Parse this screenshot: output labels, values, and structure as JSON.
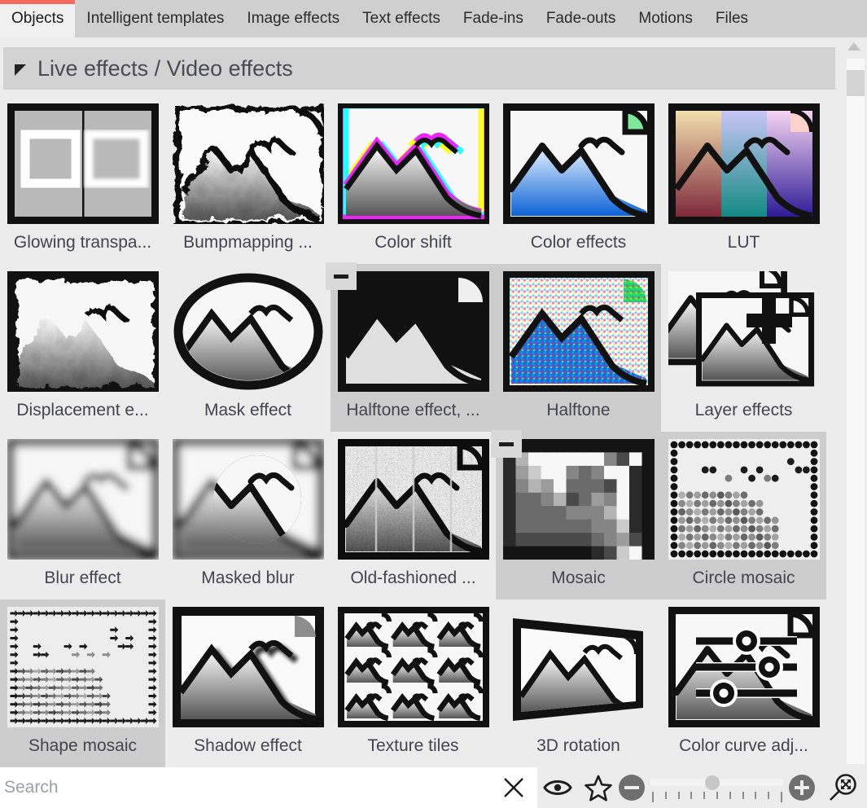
{
  "tabs": [
    {
      "label": "Objects",
      "active": true
    },
    {
      "label": "Intelligent templates",
      "active": false
    },
    {
      "label": "Image effects",
      "active": false
    },
    {
      "label": "Text effects",
      "active": false
    },
    {
      "label": "Fade-ins",
      "active": false
    },
    {
      "label": "Fade-outs",
      "active": false
    },
    {
      "label": "Motions",
      "active": false
    },
    {
      "label": "Files",
      "active": false
    }
  ],
  "accent_color": "#f2695e",
  "section": {
    "title": "Live effects / Video effects",
    "expanded": true,
    "collapse_icon": "triangle-down-icon"
  },
  "grid": {
    "columns": 5,
    "items": [
      {
        "label": "Glowing transpa...",
        "art": "glowing",
        "selected": false,
        "badge": false
      },
      {
        "label": "Bumpmapping ...",
        "art": "bumpmap",
        "selected": false,
        "badge": false
      },
      {
        "label": "Color shift",
        "art": "colorshift",
        "selected": false,
        "badge": false
      },
      {
        "label": "Color effects",
        "art": "coloreffects",
        "selected": false,
        "badge": false
      },
      {
        "label": "LUT",
        "art": "lut",
        "selected": false,
        "badge": false
      },
      {
        "label": "Displacement e...",
        "art": "displacement",
        "selected": false,
        "badge": false
      },
      {
        "label": "Mask effect",
        "art": "mask",
        "selected": false,
        "badge": false
      },
      {
        "label": "Halftone effect, ...",
        "art": "halftonebw",
        "selected": true,
        "badge": true
      },
      {
        "label": "Halftone",
        "art": "halftonecolor",
        "selected": true,
        "badge": false
      },
      {
        "label": "Layer effects",
        "art": "layer",
        "selected": false,
        "badge": false
      },
      {
        "label": "Blur effect",
        "art": "blur",
        "selected": false,
        "badge": false
      },
      {
        "label": "Masked blur",
        "art": "maskedblur",
        "selected": false,
        "badge": false
      },
      {
        "label": "Old-fashioned ...",
        "art": "oldfashioned",
        "selected": false,
        "badge": false
      },
      {
        "label": "Mosaic",
        "art": "mosaic",
        "selected": true,
        "badge": true
      },
      {
        "label": "Circle mosaic",
        "art": "circlemosaic",
        "selected": true,
        "badge": false
      },
      {
        "label": "Shape mosaic",
        "art": "shapemosaic",
        "selected": true,
        "badge": false
      },
      {
        "label": "Shadow effect",
        "art": "shadow",
        "selected": false,
        "badge": false
      },
      {
        "label": "Texture tiles",
        "art": "texturetiles",
        "selected": false,
        "badge": false
      },
      {
        "label": "3D rotation",
        "art": "rotation3d",
        "selected": false,
        "badge": false
      },
      {
        "label": "Color curve adj...",
        "art": "colorcurve",
        "selected": false,
        "badge": false
      }
    ]
  },
  "scrollbar": {
    "up_arrow_icon": "triangle-up-icon",
    "thumb_position_percent": 2
  },
  "bottom_bar": {
    "search": {
      "value": "",
      "placeholder": "Search"
    },
    "clear_icon": "close-icon",
    "preview_icon": "eye-icon",
    "favorite_icon": "star-icon",
    "zoom_out_icon": "minus-circle-icon",
    "zoom_in_icon": "plus-circle-icon",
    "fit_icon": "magnifier-fit-icon",
    "zoom_slider_value": 42,
    "zoom_slider_ticks": 11
  }
}
